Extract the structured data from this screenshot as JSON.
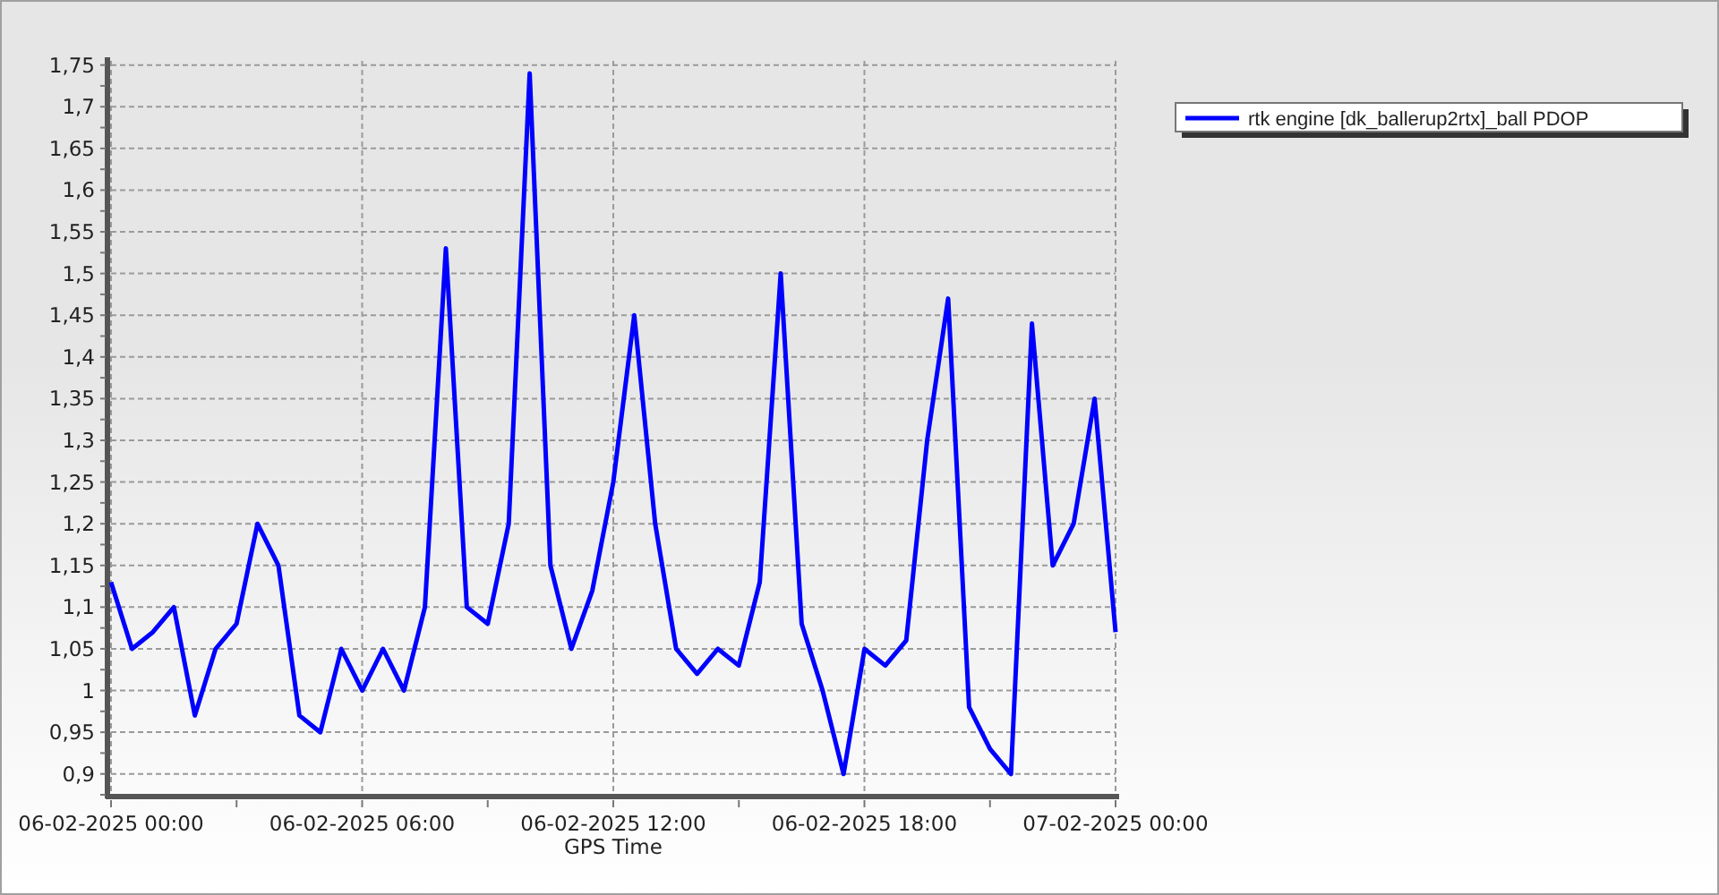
{
  "chart_data": {
    "type": "line",
    "xlabel": "GPS Time",
    "grid": true,
    "categories": [
      "06-02-2025 00:00",
      null,
      null,
      null,
      null,
      null,
      null,
      null,
      null,
      null,
      null,
      null,
      "06-02-2025 06:00",
      null,
      null,
      null,
      null,
      null,
      null,
      null,
      null,
      null,
      null,
      null,
      "06-02-2025 12:00",
      null,
      null,
      null,
      null,
      null,
      null,
      null,
      null,
      null,
      null,
      null,
      "06-02-2025 18:00",
      null,
      null,
      null,
      null,
      null,
      null,
      null,
      null,
      null,
      null,
      null,
      "07-02-2025 00:00"
    ],
    "series": [
      {
        "name": "rtk engine [dk_ballerup2rtx]_ball PDOP",
        "color": "#0000ff",
        "values": [
          1.13,
          1.05,
          1.07,
          1.1,
          0.97,
          1.05,
          1.08,
          1.2,
          1.15,
          0.97,
          0.95,
          1.05,
          1.0,
          1.05,
          1.0,
          1.1,
          1.53,
          1.1,
          1.08,
          1.2,
          1.74,
          1.15,
          1.05,
          1.12,
          1.25,
          1.45,
          1.2,
          1.05,
          1.02,
          1.05,
          1.03,
          1.13,
          1.5,
          1.08,
          1.0,
          0.9,
          1.05,
          1.03,
          1.06,
          1.3,
          1.47,
          0.98,
          0.93,
          0.9,
          1.44,
          1.15,
          1.2,
          1.35,
          1.07
        ]
      }
    ],
    "ylim": [
      0.875,
      1.755
    ],
    "yticks": [
      {
        "value": 0.9,
        "label": "0,9"
      },
      {
        "value": 0.95,
        "label": "0,95"
      },
      {
        "value": 1,
        "label": "1"
      },
      {
        "value": 1.05,
        "label": "1,05"
      },
      {
        "value": 1.1,
        "label": "1,1"
      },
      {
        "value": 1.15,
        "label": "1,15"
      },
      {
        "value": 1.2,
        "label": "1,2"
      },
      {
        "value": 1.25,
        "label": "1,25"
      },
      {
        "value": 1.3,
        "label": "1,3"
      },
      {
        "value": 1.35,
        "label": "1,35"
      },
      {
        "value": 1.4,
        "label": "1,4"
      },
      {
        "value": 1.45,
        "label": "1,45"
      },
      {
        "value": 1.5,
        "label": "1,5"
      },
      {
        "value": 1.55,
        "label": "1,55"
      },
      {
        "value": 1.6,
        "label": "1,6"
      },
      {
        "value": 1.65,
        "label": "1,65"
      },
      {
        "value": 1.7,
        "label": "1,7"
      },
      {
        "value": 1.75,
        "label": "1,75"
      }
    ]
  }
}
